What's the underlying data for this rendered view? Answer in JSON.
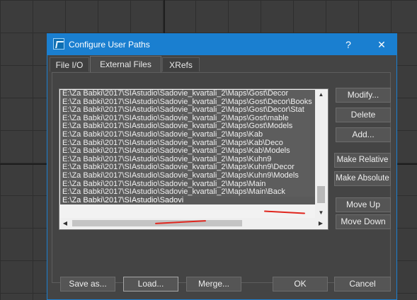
{
  "dialog": {
    "title": "Configure User Paths",
    "help_label": "?",
    "close_label": "✕"
  },
  "tabs": [
    {
      "label": "File I/O"
    },
    {
      "label": "External Files"
    },
    {
      "label": "XRefs"
    }
  ],
  "paths": [
    "E:\\Za Babki\\2017\\SIAstudio\\Sadovie_kvartali_2\\Maps\\Gost\\Decor",
    "E:\\Za Babki\\2017\\SIAstudio\\Sadovie_kvartali_2\\Maps\\Gost\\Decor\\Books",
    "E:\\Za Babki\\2017\\SIAstudio\\Sadovie_kvartali_2\\Maps\\Gost\\Decor\\Stat",
    "E:\\Za Babki\\2017\\SIAstudio\\Sadovie_kvartali_2\\Maps\\Gost\\mable",
    "E:\\Za Babki\\2017\\SIAstudio\\Sadovie_kvartali_2\\Maps\\Gost\\Models",
    "E:\\Za Babki\\2017\\SIAstudio\\Sadovie_kvartali_2\\Maps\\Kab",
    "E:\\Za Babki\\2017\\SIAstudio\\Sadovie_kvartali_2\\Maps\\Kab\\Deco",
    "E:\\Za Babki\\2017\\SIAstudio\\Sadovie_kvartali_2\\Maps\\Kab\\Models",
    "E:\\Za Babki\\2017\\SIAstudio\\Sadovie_kvartali_2\\Maps\\Kuhn9",
    "E:\\Za Babki\\2017\\SIAstudio\\Sadovie_kvartali_2\\Maps\\Kuhn9\\Decor",
    "E:\\Za Babki\\2017\\SIAstudio\\Sadovie_kvartali_2\\Maps\\Kuhn9\\Models",
    "E:\\Za Babki\\2017\\SIAstudio\\Sadovie_kvartali_2\\Maps\\Main",
    "E:\\Za Babki\\2017\\SIAstudio\\Sadovie_kvartali_2\\Maps\\Main\\Back",
    "E:\\Za Babki\\2017\\SIAstudio\\Sadovi"
  ],
  "side_buttons": {
    "modify": "Modify...",
    "delete": "Delete",
    "add": "Add...",
    "make_relative": "Make Relative",
    "make_absolute": "Make Absolute",
    "move_up": "Move Up",
    "move_down": "Move Down"
  },
  "bottom_buttons": {
    "save_as": "Save as...",
    "load": "Load...",
    "merge": "Merge...",
    "ok": "OK",
    "cancel": "Cancel"
  },
  "colors": {
    "titlebar": "#1a7fd0",
    "dialog_bg": "#444444",
    "annotation": "#e0261e"
  }
}
